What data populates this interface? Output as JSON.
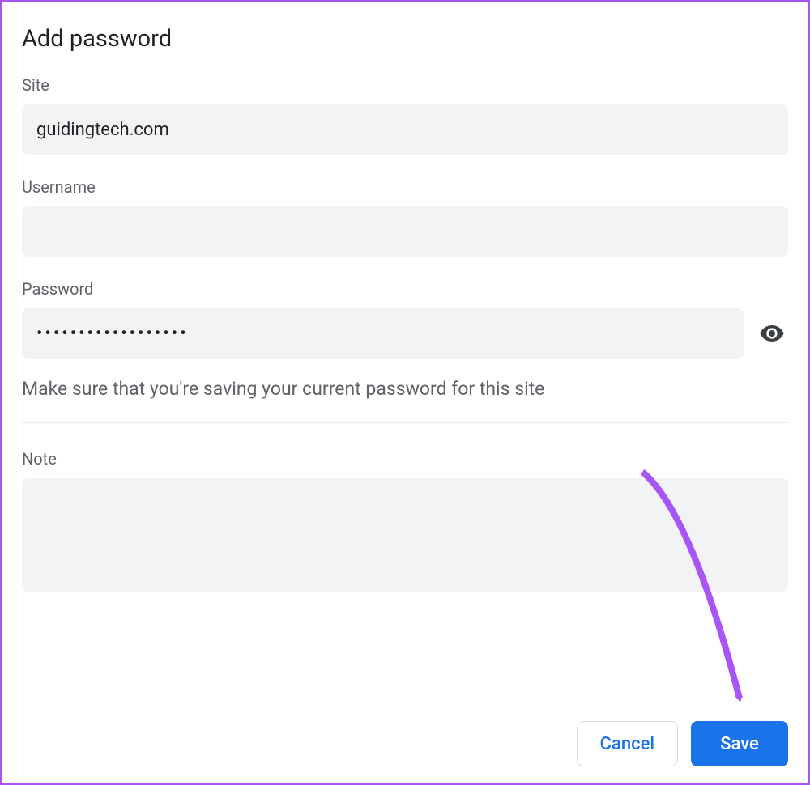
{
  "dialog": {
    "title": "Add password"
  },
  "fields": {
    "site": {
      "label": "Site",
      "value": "guidingtech.com"
    },
    "username": {
      "label": "Username",
      "value": ""
    },
    "password": {
      "label": "Password",
      "value": "••••••••••••••••••",
      "helper": "Make sure that you're saving your current password for this site"
    },
    "note": {
      "label": "Note",
      "value": ""
    }
  },
  "buttons": {
    "cancel": "Cancel",
    "save": "Save"
  }
}
